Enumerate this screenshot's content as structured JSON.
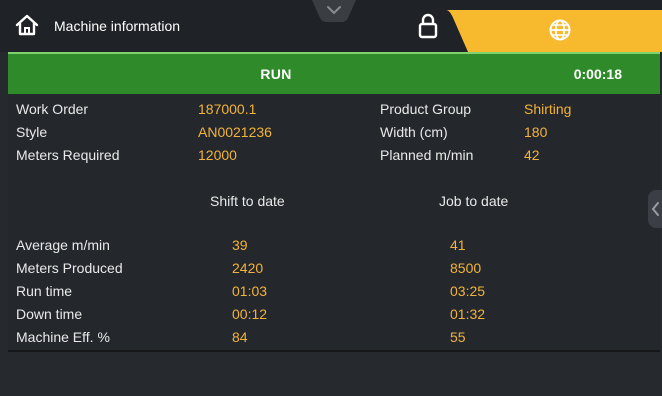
{
  "header": {
    "title": "Machine information",
    "icons": {
      "home": "home-icon",
      "collapse": "chevron-down-icon",
      "lock": "lock-icon",
      "language": "globe-icon"
    },
    "accent_color": "#f7b92e"
  },
  "status": {
    "state": "RUN",
    "elapsed": "0:00:18",
    "color": "#2f8a2a"
  },
  "info": {
    "left": [
      {
        "label": "Work Order",
        "value": "187000.1"
      },
      {
        "label": "Style",
        "value": "AN0021236"
      },
      {
        "label": "Meters Required",
        "value": "12000"
      }
    ],
    "right": [
      {
        "label": "Product Group",
        "value": "Shirting"
      },
      {
        "label": "Width (cm)",
        "value": "180"
      },
      {
        "label": "Planned m/min",
        "value": "42"
      }
    ]
  },
  "stats": {
    "col_shift": "Shift to date",
    "col_job": "Job to date",
    "rows": [
      {
        "label": "Average m/min",
        "shift": "39",
        "job": "41"
      },
      {
        "label": "Meters Produced",
        "shift": "2420",
        "job": "8500"
      },
      {
        "label": "Run time",
        "shift": "01:03",
        "job": "03:25"
      },
      {
        "label": "Down time",
        "shift": "00:12",
        "job": "01:32"
      },
      {
        "label": "Machine Eff. %",
        "shift": "84",
        "job": "55"
      }
    ]
  },
  "value_color": "#f2b33a"
}
